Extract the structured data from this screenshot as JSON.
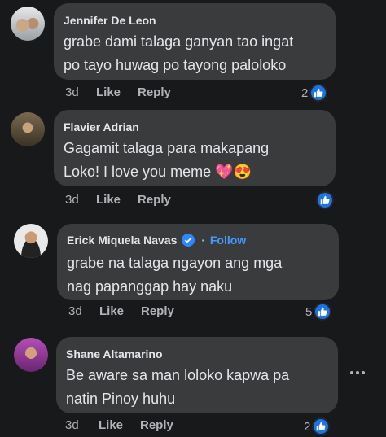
{
  "comments": [
    {
      "author": "Jennifer De Leon",
      "text_lines": [
        "grabe dami talaga ganyan tao ingat",
        "po tayo huwag po tayong paloloko"
      ],
      "time": "3d",
      "like_label": "Like",
      "reply_label": "Reply",
      "reaction_count": "2",
      "reaction_icon": "thumbs-up-icon",
      "avatar_color": "#8a8f96"
    },
    {
      "author": "Flavier Adrian",
      "text_lines": [
        "Gagamit talaga para makapang",
        "Loko! I love you meme 💖😍"
      ],
      "time": "3d",
      "like_label": "Like",
      "reply_label": "Reply",
      "reaction_count": "",
      "reaction_icon": "thumbs-up-icon",
      "avatar_color": "#5b4a2f"
    },
    {
      "author": "Erick Miquela Navas",
      "verified_icon": "verified-badge-icon",
      "separator": "·",
      "follow_label": "Follow",
      "text_lines": [
        "grabe na talaga ngayon ang mga",
        "nag papanggap hay naku"
      ],
      "time": "3d",
      "like_label": "Like",
      "reply_label": "Reply",
      "reaction_count": "5",
      "reaction_icon": "thumbs-up-icon",
      "avatar_color": "#d9d9d9"
    },
    {
      "author": "Shane Altamarino",
      "text_lines": [
        "Be aware sa man loloko kapwa pa",
        "natin Pinoy huhu"
      ],
      "time": "3d",
      "like_label": "Like",
      "reply_label": "Reply",
      "reaction_count": "2",
      "reaction_icon": "thumbs-up-icon",
      "avatar_color": "#9a3fa0"
    }
  ],
  "more_icon": "more-options-icon",
  "colors": {
    "background": "#18191a",
    "bubble": "#3a3b3c",
    "like_blue": "#1b74e4",
    "follow_blue": "#4599ff"
  }
}
